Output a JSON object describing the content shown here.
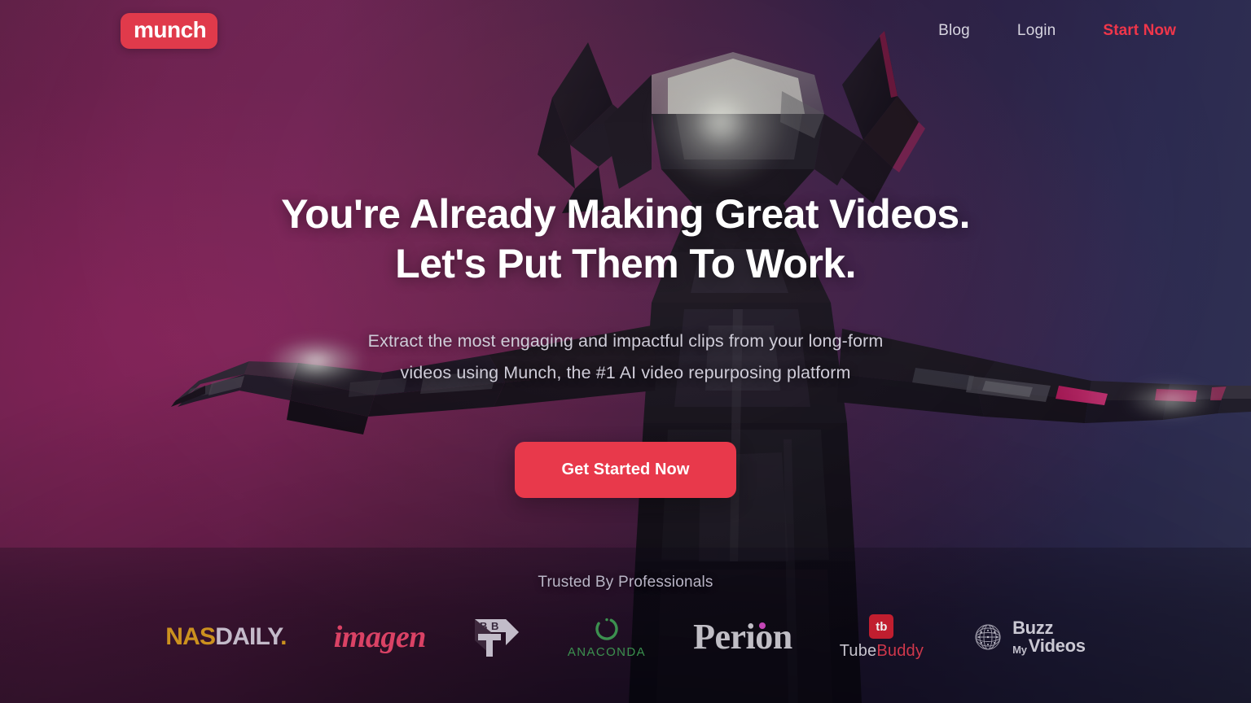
{
  "brand": {
    "logo_text": "munch",
    "logo_bg": "#e03a4b"
  },
  "nav": {
    "links": [
      {
        "label": "Blog"
      },
      {
        "label": "Login"
      }
    ],
    "cta": {
      "label": "Start Now",
      "color": "#f0364a"
    }
  },
  "hero": {
    "headline_line1": "You're Already Making Great Videos.",
    "headline_line2": "Let's Put Them To Work.",
    "subhead_line1": "Extract the most engaging and impactful clips from your long-form",
    "subhead_line2": "videos using Munch, the #1 AI video repurposing platform",
    "cta_label": "Get Started Now",
    "cta_color": "#e8394b"
  },
  "trusted": {
    "title": "Trusted By Professionals",
    "logos": [
      {
        "name": "nasdaily",
        "part1": "NAS",
        "part2": "DAILY",
        "part3": ".",
        "color1": "#d79b1e",
        "color2": "#cfc7d6"
      },
      {
        "name": "imagen",
        "label": "imagen",
        "color": "#e8466a"
      },
      {
        "name": "bbtv",
        "label": "BBTV",
        "color": "#cfc9d6"
      },
      {
        "name": "anaconda",
        "label": "ANACONDA",
        "color": "#3f9b53"
      },
      {
        "name": "perion",
        "label": "Perion",
        "color": "#cfcdd4",
        "accent": "#d34bc4"
      },
      {
        "name": "tubebuddy",
        "mark": "tb",
        "part1": "Tube",
        "part2": "Buddy",
        "color1": "#d4d1da",
        "color2": "#de3a4e"
      },
      {
        "name": "buzzmyvideos",
        "part1": "Buzz",
        "part2": "My",
        "part3": "Videos",
        "color": "#d8d6e0"
      }
    ]
  }
}
